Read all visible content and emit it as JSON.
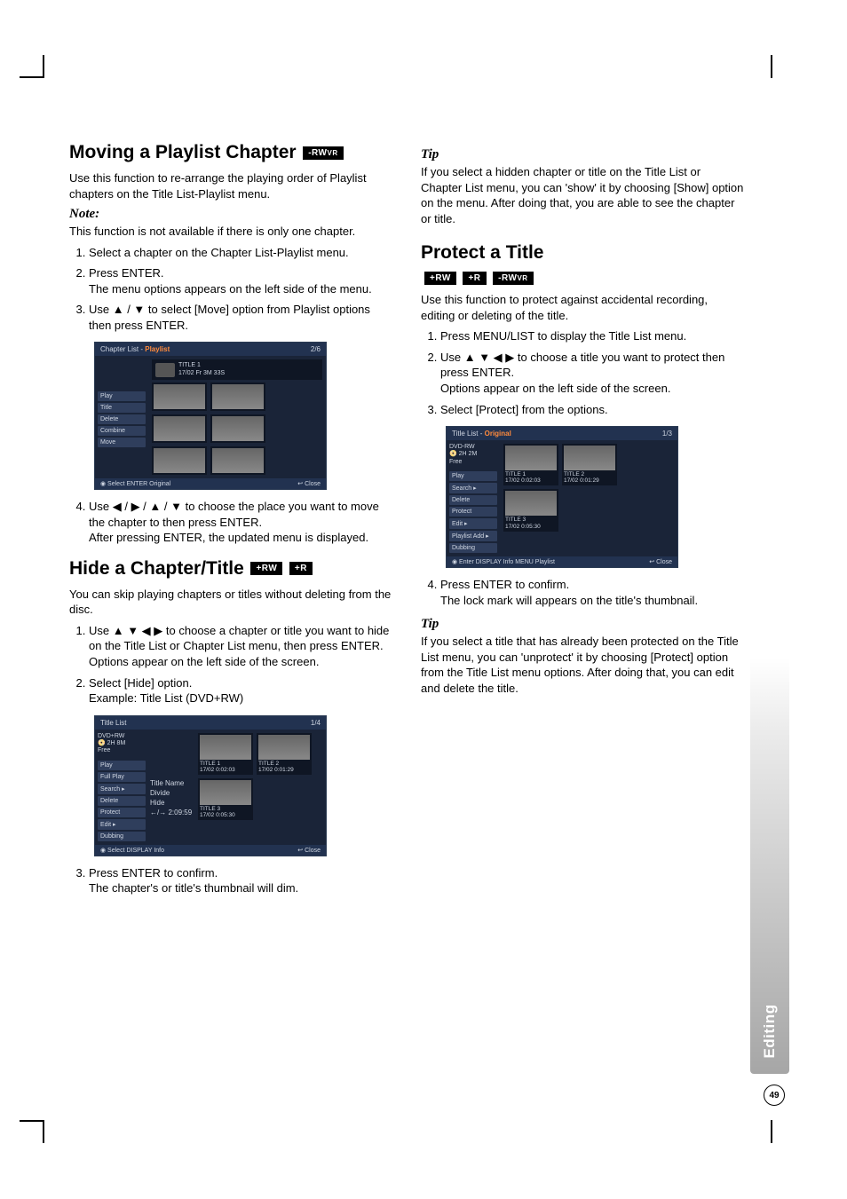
{
  "page_number": "49",
  "side_tab": "Editing",
  "badges": {
    "rwvr": "-RW",
    "rwvr_sub": "VR",
    "plus_rw": "+RW",
    "plus_r": "+R"
  },
  "left": {
    "s1": {
      "title": "Moving a Playlist Chapter",
      "intro": "Use this function to re-arrange the playing order of Playlist chapters on the Title List-Playlist menu.",
      "note_label": "Note:",
      "note_body": "This function is not available if there is only one chapter.",
      "steps": {
        "1": "Select a chapter on the Chapter List-Playlist menu.",
        "2a": "Press ENTER.",
        "2b": "The menu options appears on the left side of the menu.",
        "3": "Use ▲ / ▼ to select [Move] option from Playlist options then press ENTER.",
        "4a": "Use ◀ / ▶ / ▲ / ▼ to choose the place you want to move the chapter to then press ENTER.",
        "4b": "After pressing ENTER, the updated menu is displayed."
      },
      "shot": {
        "bar_left": "Chapter List - ",
        "bar_left_accent": "Playlist",
        "bar_right": "2/6",
        "info_t": "TITLE 1",
        "info_d": "17/02 Fr   3M 33S",
        "menu": [
          "Play",
          "Title",
          "Delete",
          "Combine",
          "Move"
        ],
        "foot_l": "◉ Select  ENTER Original",
        "foot_r": "↩ Close"
      }
    },
    "s2": {
      "title": "Hide a Chapter/Title",
      "intro": "You can skip playing chapters or titles without deleting from the disc.",
      "steps": {
        "1a": "Use ▲ ▼ ◀ ▶ to choose a chapter or title you want to hide on the Title List or Chapter List menu, then press ENTER.",
        "1b": "Options appear on the left side of the screen.",
        "2a": "Select [Hide] option.",
        "2b": "Example: Title List (DVD+RW)",
        "3a": "Press ENTER to confirm.",
        "3b": "The chapter's or title's thumbnail will dim."
      },
      "shot": {
        "bar_left": "Title List",
        "bar_right": "1/4",
        "top1": "DVD+RW",
        "top2": "📀 2H 8M",
        "top3": "Free",
        "menu": [
          "Play",
          "Full Play",
          "Search",
          "Delete",
          "Protect",
          "Edit",
          "Dubbing"
        ],
        "submenu": [
          "Title Name",
          "Divide",
          "Hide"
        ],
        "foot_l": "◉ Select  DISPLAY Info",
        "foot_r": "↩ Close",
        "thumbs": [
          {
            "t": "TITLE 1",
            "d": "17/02   0:02:03"
          },
          {
            "t": "TITLE 2",
            "d": "17/02   0:01:29"
          },
          {
            "t": "TITLE 3",
            "d": "17/02   0:05:30"
          }
        ],
        "sel_sub": "←/→   2:09:59"
      }
    }
  },
  "right": {
    "tip1_label": "Tip",
    "tip1_body": "If you select a hidden chapter or title on the Title List or Chapter List menu, you can 'show' it by choosing [Show] option on the menu. After doing that, you are able to see the chapter or title.",
    "s3": {
      "title": "Protect a Title",
      "intro": "Use this function to protect against accidental recording, editing or deleting of the title.",
      "steps": {
        "1": "Press MENU/LIST to display the Title List menu.",
        "2a": "Use ▲ ▼ ◀ ▶ to choose a title you want to protect then press ENTER.",
        "2b": "Options appear on the left side of the screen.",
        "3": "Select [Protect] from the options.",
        "4a": "Press ENTER to confirm.",
        "4b": "The lock mark will appears on the title's thumbnail."
      },
      "shot": {
        "bar_left": "Title List - ",
        "bar_left_accent": "Original",
        "bar_right": "1/3",
        "top1": "DVD-RW",
        "top2": "📀 2H 2M",
        "top3": "Free",
        "menu": [
          "Play",
          "Search",
          "Delete",
          "Protect",
          "Edit",
          "Playlist Add ▸",
          "Dubbing"
        ],
        "foot_l": "◉ Enter  DISPLAY Info  MENU Playlist",
        "foot_r": "↩ Close",
        "thumbs": [
          {
            "t": "TITLE 1",
            "d": "17/02   0:02:03"
          },
          {
            "t": "TITLE 2",
            "d": "17/02   0:01:29"
          },
          {
            "t": "TITLE 3",
            "d": "17/02   0:05:30"
          }
        ]
      }
    },
    "tip2_label": "Tip",
    "tip2_body": "If you select a title that has already been protected on the Title List menu, you can 'unprotect' it by choosing [Protect] option from the Title List menu options. After doing that, you can edit and delete the title."
  }
}
